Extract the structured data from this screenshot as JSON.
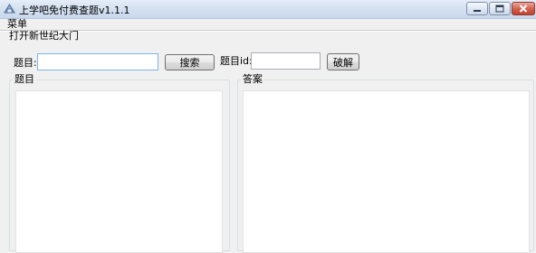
{
  "window": {
    "title": "上学吧免付费查题v1.1.1",
    "controls": {
      "minimize": "minimize-icon",
      "maximize": "maximize-icon",
      "close": "close-icon"
    }
  },
  "menu": {
    "items": [
      {
        "label": "菜单"
      }
    ]
  },
  "link_label": "打开新世纪大门",
  "search": {
    "label": "题目:",
    "value": "",
    "button": "搜索"
  },
  "decode": {
    "label": "题目id:",
    "value": "",
    "button": "破解"
  },
  "panels": {
    "question": {
      "title": "题目",
      "content": ""
    },
    "answer": {
      "title": "答案",
      "content": ""
    }
  },
  "colors": {
    "titlebar": "#d3e0f0",
    "close_button": "#c94a36",
    "window_bg": "#f0f0f0"
  }
}
